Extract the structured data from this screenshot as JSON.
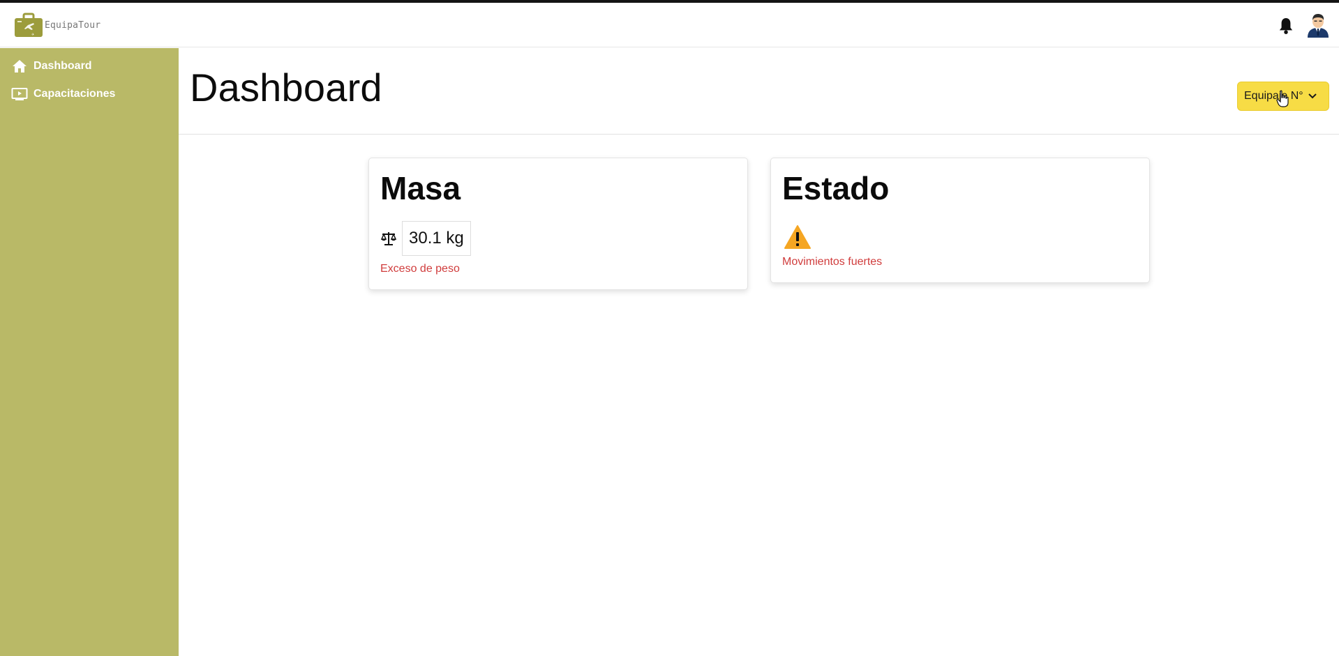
{
  "app": {
    "brand_name": "EquipaTour"
  },
  "sidebar": {
    "items": [
      {
        "label": "Dashboard",
        "icon": "home-icon"
      },
      {
        "label": "Capacitaciones",
        "icon": "video-icon"
      }
    ]
  },
  "header": {
    "notifications_icon": "bell-icon",
    "avatar_icon": "user-avatar"
  },
  "page": {
    "title": "Dashboard",
    "dropdown_label": "Equipaje N°"
  },
  "cards": {
    "masa": {
      "title": "Masa",
      "icon": "scale-icon",
      "value": "30.1 kg",
      "alert": "Exceso de peso"
    },
    "estado": {
      "title": "Estado",
      "icon": "warning-icon",
      "alert": "Movimientos fuertes"
    }
  },
  "colors": {
    "sidebar_bg": "#b9b967",
    "button_bg": "#f7dc45",
    "alert_text": "#d03c3c",
    "warning": "#f5a623"
  }
}
